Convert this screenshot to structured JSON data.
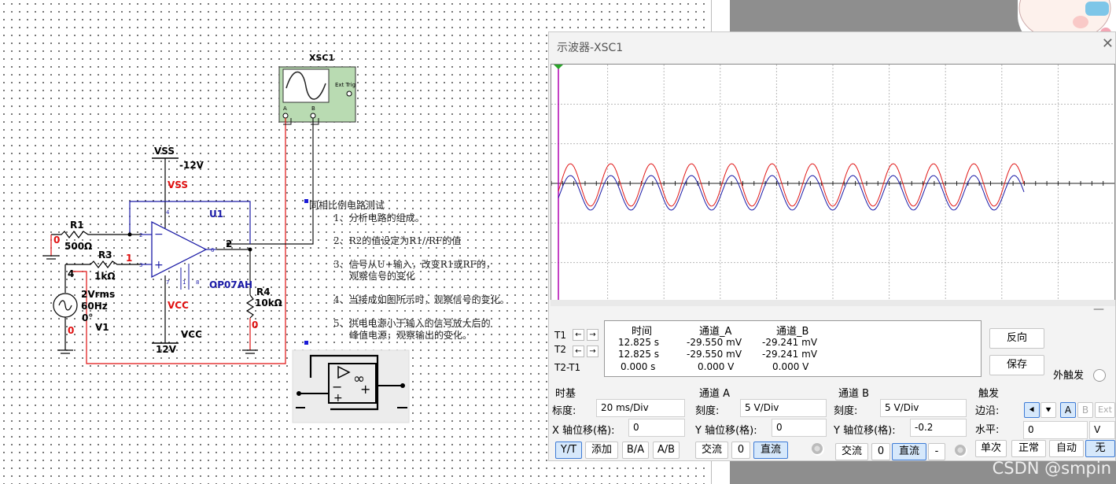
{
  "schematic": {
    "scope_ref": "XSC1",
    "scope_ext_trig": "Ext Trig",
    "scope_a": "A",
    "scope_b": "B",
    "vss_label": "VSS",
    "vss_value": "-12V",
    "vss_pin": "VSS",
    "vcc_pin": "VCC",
    "vcc_label": "VCC",
    "vcc_value": "12V",
    "u1": "U1",
    "opamp_model": "OP07AH",
    "pin4": "4",
    "pin7": "7",
    "pin1": "1",
    "pin8": "8",
    "pin2": "2",
    "pin3": "3",
    "pin6": "6",
    "r1": "R1",
    "r1_value": "500Ω",
    "r3": "R3",
    "r3_value": "1kΩ",
    "r4": "R4",
    "r4_value": "10kΩ",
    "v1": "V1",
    "v1_amp": "2Vrms",
    "v1_freq": "60Hz",
    "v1_phase": "0°",
    "net0_a": "0",
    "net0_b": "0",
    "net0_c": "0",
    "net4": "4",
    "net1": "1",
    "net2": "2"
  },
  "notes": {
    "title": "同相比例电路测试",
    "l1": "1、分析电路的组成。",
    "l2": "2、R2的值设定为R1//RF的值",
    "l3a": "3、信号从U+输入，改变R1或RF的，",
    "l3b": "观察信号的变化",
    "l4": "4、当接成如图所示时，观察信号的变化。",
    "l5a": "5、供电电源小于输入的信号放大后的",
    "l5b": "峰值电源，观察输出的变化。"
  },
  "scope": {
    "title": "示波器-XSC1",
    "close": "✕",
    "minimize": "—",
    "t1": "T1",
    "t2": "T2",
    "t2t1": "T2-T1",
    "left_arrow": "←",
    "right_arrow": "→",
    "col_time": "时间",
    "col_a": "通道_A",
    "col_b": "通道_B",
    "rows": [
      {
        "time": "12.825 s",
        "a": "-29.550 mV",
        "b": "-29.241 mV"
      },
      {
        "time": "12.825 s",
        "a": "-29.550 mV",
        "b": "-29.241 mV"
      },
      {
        "time": "0.000 s",
        "a": "0.000 V",
        "b": "0.000 V"
      }
    ],
    "reverse": "反向",
    "save": "保存",
    "ext_trigger": "外触发",
    "timebase": {
      "title": "时基",
      "scale_label": "标度:",
      "scale": "20 ms/Div",
      "xpos_label": "X 轴位移(格):",
      "xpos": "0",
      "yt": "Y/T",
      "add": "添加",
      "ba": "B/A",
      "ab": "A/B"
    },
    "channel_a": {
      "title": "通道 A",
      "scale_label": "刻度:",
      "scale": "5  V/Div",
      "ypos_label": "Y 轴位移(格):",
      "ypos": "0",
      "ac": "交流",
      "zero": "0",
      "dc": "直流"
    },
    "channel_b": {
      "title": "通道 B",
      "scale_label": "刻度:",
      "scale": "5  V/Div",
      "ypos_label": "Y 轴位移(格):",
      "ypos": "-0.2",
      "ac": "交流",
      "zero": "0",
      "dc": "直流",
      "minus": "-"
    },
    "trigger": {
      "title": "触发",
      "edge_label": "边沿:",
      "level_label": "水平:",
      "level": "0",
      "level_unit": "V",
      "src_a": "A",
      "src_b": "B",
      "src_ext": "Ext",
      "single": "单次",
      "normal": "正常",
      "auto": "自动",
      "none": "无"
    },
    "colors": {
      "channel_a": "#e01818",
      "channel_b": "#1a1aa6",
      "cursor": "#b000b0"
    }
  },
  "watermark": "CSDN @smpin"
}
